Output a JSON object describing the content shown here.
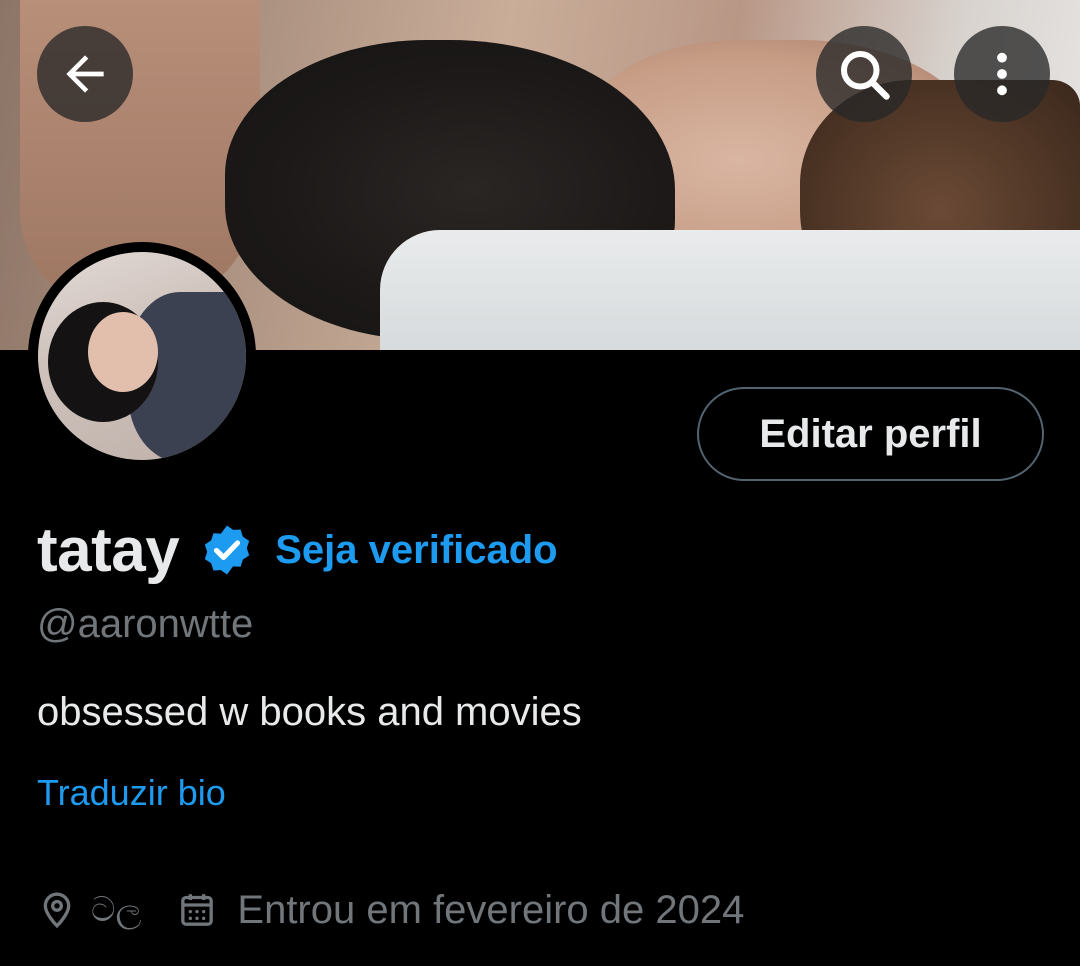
{
  "header": {
    "back_icon": "arrow-left-icon",
    "search_icon": "search-icon",
    "more_icon": "more-vertical-icon"
  },
  "profile": {
    "edit_button_label": "Editar perfil",
    "display_name": "tatay",
    "verified_badge_icon": "verified-badge-icon",
    "verify_link": "Seja verificado",
    "handle": "@aaronwtte",
    "bio": "obsessed w books and movies",
    "translate_bio": "Traduzir bio",
    "location_icon": "location-pin-icon",
    "location": "ටල",
    "calendar_icon": "calendar-icon",
    "joined": "Entrou em fevereiro de 2024"
  },
  "colors": {
    "background": "#000000",
    "accent": "#1d9bf0",
    "primary_text": "#e7e9ea",
    "secondary_text": "#71767b",
    "button_border": "#536471"
  }
}
